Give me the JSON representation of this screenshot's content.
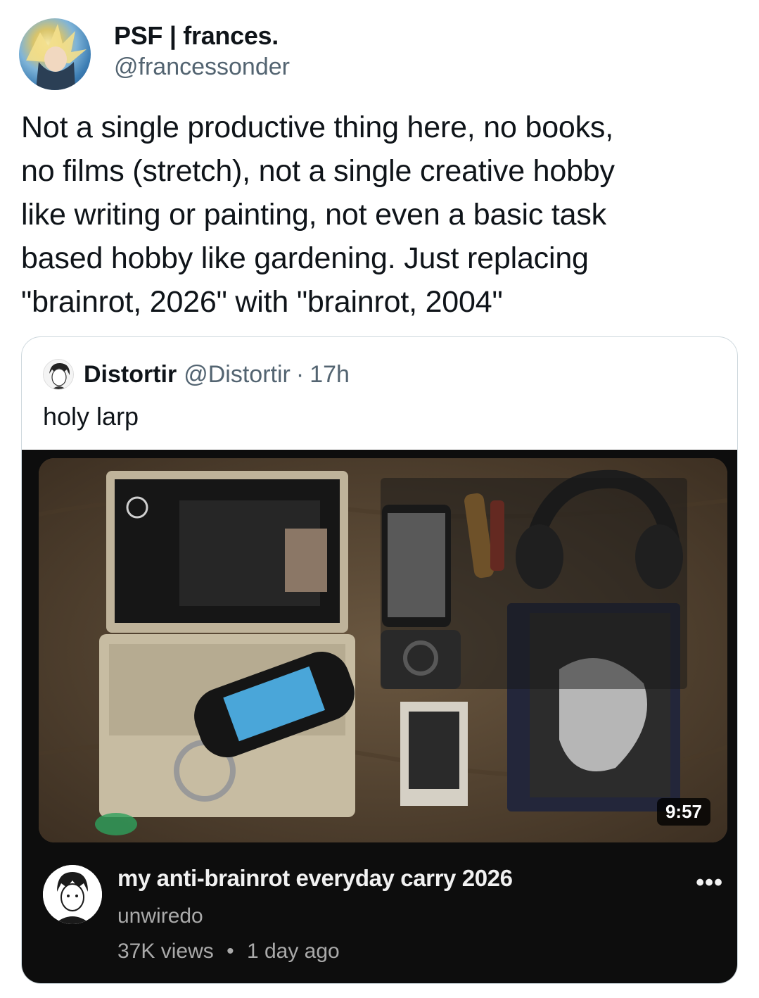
{
  "tweet": {
    "display_name": "PSF | frances.",
    "handle": "@francessonder",
    "text": "Not a single productive thing here, no books,\nno films (stretch), not a single creative hobby\nlike writing or painting, not even a basic task\nbased hobby like gardening. Just replacing\n\"brainrot, 2026\" with \"brainrot, 2004\""
  },
  "quoted_tweet": {
    "display_name": "Distortir",
    "handle": "@Distortir",
    "separator": "·",
    "time": "17h",
    "text": "holy larp"
  },
  "video": {
    "duration": "9:57",
    "title": "my anti-brainrot everyday carry 2026",
    "channel": "unwiredo",
    "views": "37K views",
    "separator": "•",
    "age": "1 day ago",
    "more_icon": "more-options-icon"
  }
}
